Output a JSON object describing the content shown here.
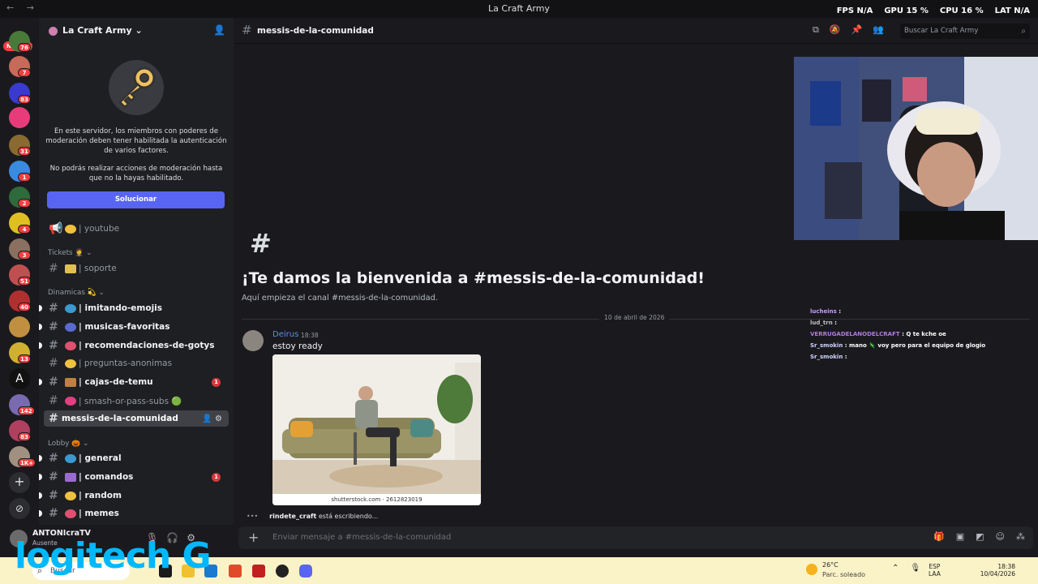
{
  "topbar": {
    "title": "La Craft Army",
    "nav": "← →",
    "fps_label": "FPS",
    "fps_value": "N/A",
    "gpu_label": "GPU",
    "gpu_value": "15 %",
    "cpu_label": "CPU",
    "cpu_value": "16 %",
    "lat_label": "LAT",
    "lat_value": "N/A"
  },
  "rail": {
    "new_label": "NUEVO",
    "badges": [
      "76",
      "7",
      "83",
      "31",
      "1",
      "2",
      "4",
      "3",
      "51",
      "40",
      "13",
      "142",
      "83",
      "1K+"
    ]
  },
  "server": {
    "name": "La Craft Army ⌄",
    "notice": "En este servidor, los miembros con poderes de moderación deben tener habilitada la autenticación de varios factores.",
    "notice2": "No podrás realizar acciones de moderación hasta que no la hayas habilitado.",
    "fix_button": "Solucionar"
  },
  "channels": {
    "youtube": "| youtube",
    "cat_tickets": "Tickets 🤵 ⌄",
    "soporte": "| soporte",
    "cat_dinamicas": "Dinamicas 💫 ⌄",
    "imitando": "| imitando-emojis",
    "musicas": "| musicas-favoritas",
    "recomendaciones": "| recomendaciones-de-gotys",
    "preguntas": "| preguntas-anonimas",
    "cajas": "| cajas-de-temu",
    "cajas_badge": "1",
    "smash": "| smash-or-pass-subs 🟢",
    "messis": "messis-de-la-comunidad",
    "cat_lobby": "Lobby 🎃 ⌄",
    "general": "| general",
    "comandos": "| comandos",
    "comandos_badge": "1",
    "random": "| random",
    "memes": "| memes"
  },
  "user": {
    "name": "ANTONIcraTV",
    "status": "Ausente"
  },
  "chat": {
    "channel": "messis-de-la-comunidad",
    "search_placeholder": "Buscar La Craft Army",
    "welcome_hash": "#",
    "welcome_title": "¡Te damos la bienvenida a #messis-de-la-comunidad!",
    "welcome_sub": "Aquí empieza el canal #messis-de-la-comunidad.",
    "date_divider": "10 de abril de 2026",
    "message": {
      "author": "Deirus",
      "time": "18:38",
      "text": "estoy ready",
      "image_credit": "shutterstock.com · 2612823019"
    },
    "typing_user": "rindete_craft",
    "typing_text": " está escribiendo...",
    "composer_placeholder": "Enviar mensaje a #messis-de-la-comunidad"
  },
  "stream_chat": [
    {
      "user": "lucheins",
      "text": ":"
    },
    {
      "user": "lud_trn",
      "text": ":"
    },
    {
      "user": "VERRUGADELANODELCRAFT",
      "text": ": Q te kche oe"
    },
    {
      "user": "Sr_smokin",
      "text": ": mano 🦎 voy pero para el equipo de glogio"
    },
    {
      "user": "Sr_smokin",
      "text": ":"
    }
  ],
  "watermark": "logitech G",
  "taskbar": {
    "search_placeholder": "Buscar",
    "temp": "26°C",
    "weather": "Parc. soleado",
    "lang1": "ESP",
    "lang2": "LAA",
    "time": "18:38",
    "date": "10/04/2026"
  },
  "colors": {
    "accent": "#5865f2",
    "badge": "#f23f43",
    "author": "#5a8ee8"
  }
}
